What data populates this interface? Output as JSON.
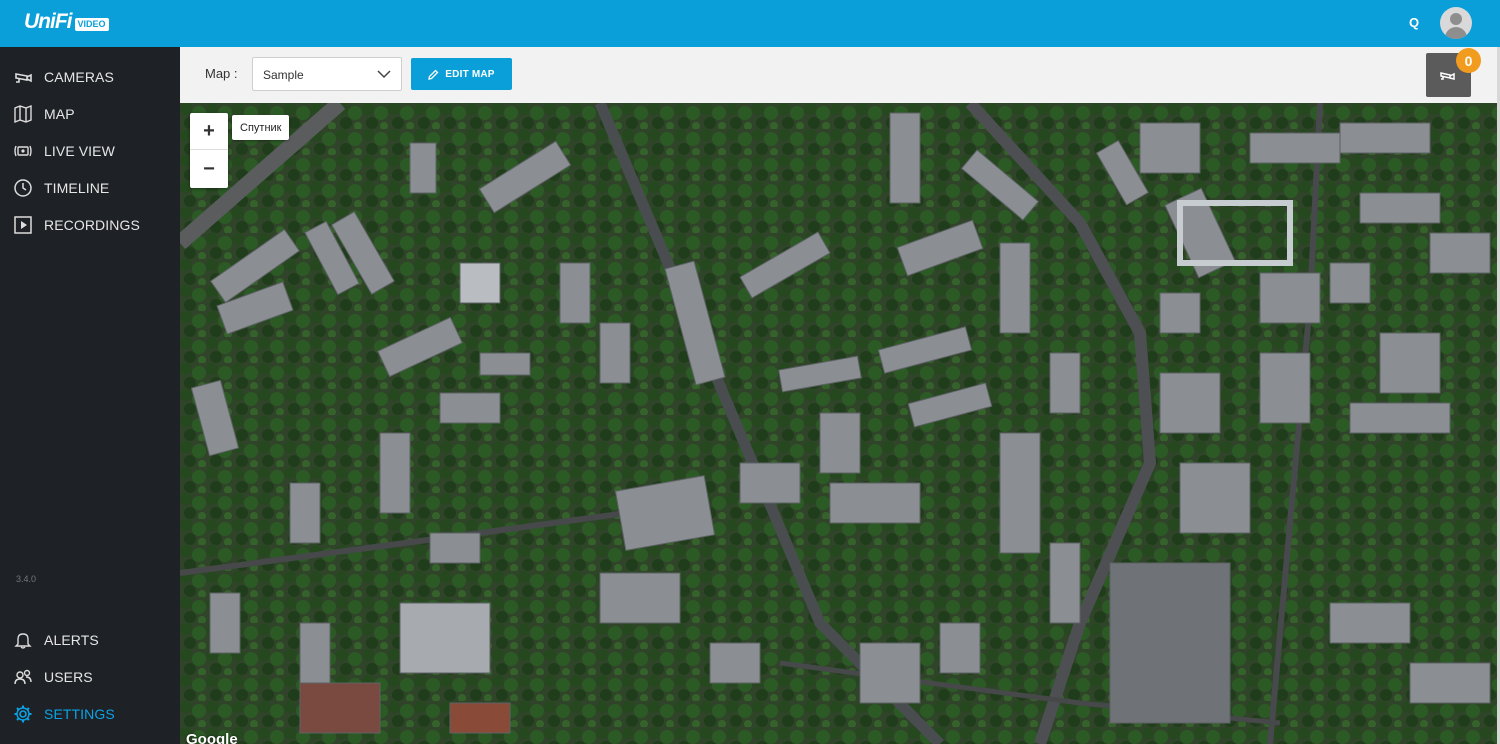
{
  "app": {
    "logo": "UniFi",
    "logo_badge": "VIDEO"
  },
  "header": {
    "search_label": "Q"
  },
  "sidebar": {
    "items": [
      {
        "label": "CAMERAS",
        "icon": "camera-icon"
      },
      {
        "label": "MAP",
        "icon": "map-icon"
      },
      {
        "label": "LIVE VIEW",
        "icon": "live-view-icon"
      },
      {
        "label": "TIMELINE",
        "icon": "clock-icon"
      },
      {
        "label": "RECORDINGS",
        "icon": "recordings-icon"
      }
    ],
    "version": "3.4.0",
    "bottom_items": [
      {
        "label": "ALERTS",
        "icon": "bell-icon"
      },
      {
        "label": "USERS",
        "icon": "users-icon"
      },
      {
        "label": "SETTINGS",
        "icon": "gear-icon",
        "active": true
      }
    ],
    "active_color": "#0aa4e6"
  },
  "toolbar": {
    "map_label": "Map :",
    "map_select_value": "Sample",
    "edit_button": "EDIT MAP",
    "camera_count": "0"
  },
  "map": {
    "zoom_in": "+",
    "zoom_out": "−",
    "map_type": "Спутник",
    "attribution": "Google"
  },
  "colors": {
    "topbar": "#0a9fd8",
    "sidebar": "#1e2125",
    "badge": "#f29c1f"
  }
}
